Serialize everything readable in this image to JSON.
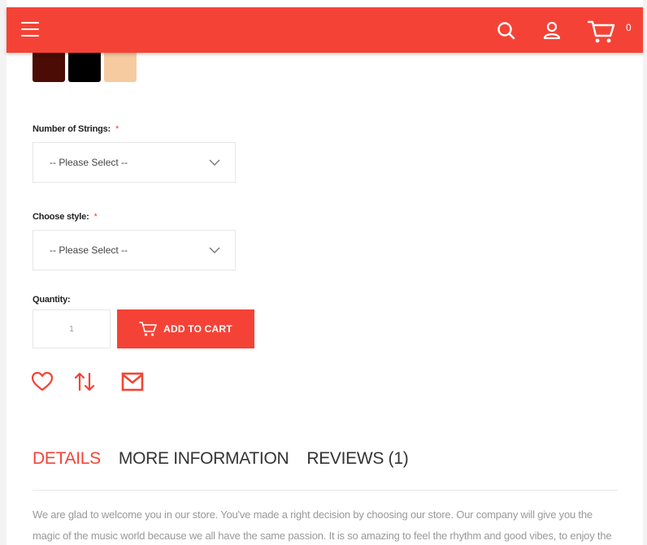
{
  "header": {
    "menu_icon": "hamburger-icon",
    "search_icon": "search-icon",
    "account_icon": "user-icon",
    "cart_icon": "cart-icon",
    "cart_count": "0",
    "bar_color": "#f44336"
  },
  "swatches": [
    {
      "color": "#4a0c05"
    },
    {
      "color": "#000000"
    },
    {
      "color": "#f7cba0"
    }
  ],
  "options": {
    "strings": {
      "label": "Number of Strings:",
      "required_mark": "*",
      "value": "-- Please Select --"
    },
    "style": {
      "label": "Choose style:",
      "required_mark": "*",
      "value": "-- Please Select --"
    }
  },
  "quantity": {
    "label": "Quantity:",
    "value": "1"
  },
  "add_to_cart": {
    "label": "ADD TO CART"
  },
  "actions": {
    "wishlist_icon": "heart-icon",
    "compare_icon": "compare-arrows-icon",
    "email_icon": "mail-icon"
  },
  "tabs": [
    {
      "label": "DETAILS",
      "active": true
    },
    {
      "label": "MORE INFORMATION",
      "active": false
    },
    {
      "label": "REVIEWS (1)",
      "active": false
    }
  ],
  "description": "We are glad to welcome you in our store. You've made a right decision by choosing our store. Our company will give you the magic of the music world because we all have the same passion. It is so amazing to feel the rhythm and good vibes, to enjoy the perfect"
}
